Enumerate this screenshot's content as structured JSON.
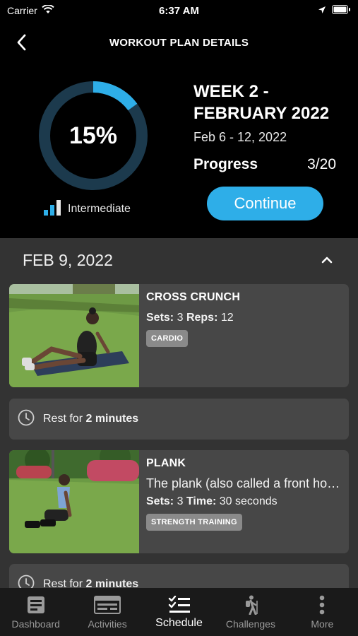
{
  "status_bar": {
    "carrier": "Carrier",
    "time": "6:37 AM"
  },
  "header": {
    "title": "WORKOUT PLAN DETAILS"
  },
  "summary": {
    "progress_percent": "15%",
    "progress_fraction": 0.15,
    "level": "Intermediate",
    "week_title": "WEEK 2 - FEBRUARY 2022",
    "date_range": "Feb 6 - 12, 2022",
    "progress_label": "Progress",
    "progress_count": "3/20",
    "continue_label": "Continue"
  },
  "day": {
    "date": "FEB 9, 2022"
  },
  "exercises": [
    {
      "title": "CROSS CRUNCH",
      "sets_label": "Sets:",
      "sets": "3",
      "metric_label": "Reps:",
      "metric": "12",
      "tag": "CARDIO"
    },
    {
      "title": "PLANK",
      "description": "The plank (also called a front hold, hover, or abdominal bridge)",
      "sets_label": "Sets:",
      "sets": "3",
      "metric_label": "Time:",
      "metric": "30 seconds",
      "tag": "STRENGTH TRAINING"
    }
  ],
  "rests": [
    {
      "prefix": "Rest for",
      "duration": "2 minutes"
    },
    {
      "prefix": "Rest for",
      "duration": "2 minutes"
    }
  ],
  "tabs": [
    {
      "label": "Dashboard",
      "icon": "dashboard-icon"
    },
    {
      "label": "Activities",
      "icon": "activities-icon"
    },
    {
      "label": "Schedule",
      "icon": "schedule-icon",
      "active": true
    },
    {
      "label": "Challenges",
      "icon": "hiker-icon"
    },
    {
      "label": "More",
      "icon": "more-icon"
    }
  ],
  "colors": {
    "accent": "#2eaee8",
    "ring_track": "#1c3a4d",
    "background": "#000000",
    "content_bg": "#333333",
    "card_bg": "#474747"
  }
}
